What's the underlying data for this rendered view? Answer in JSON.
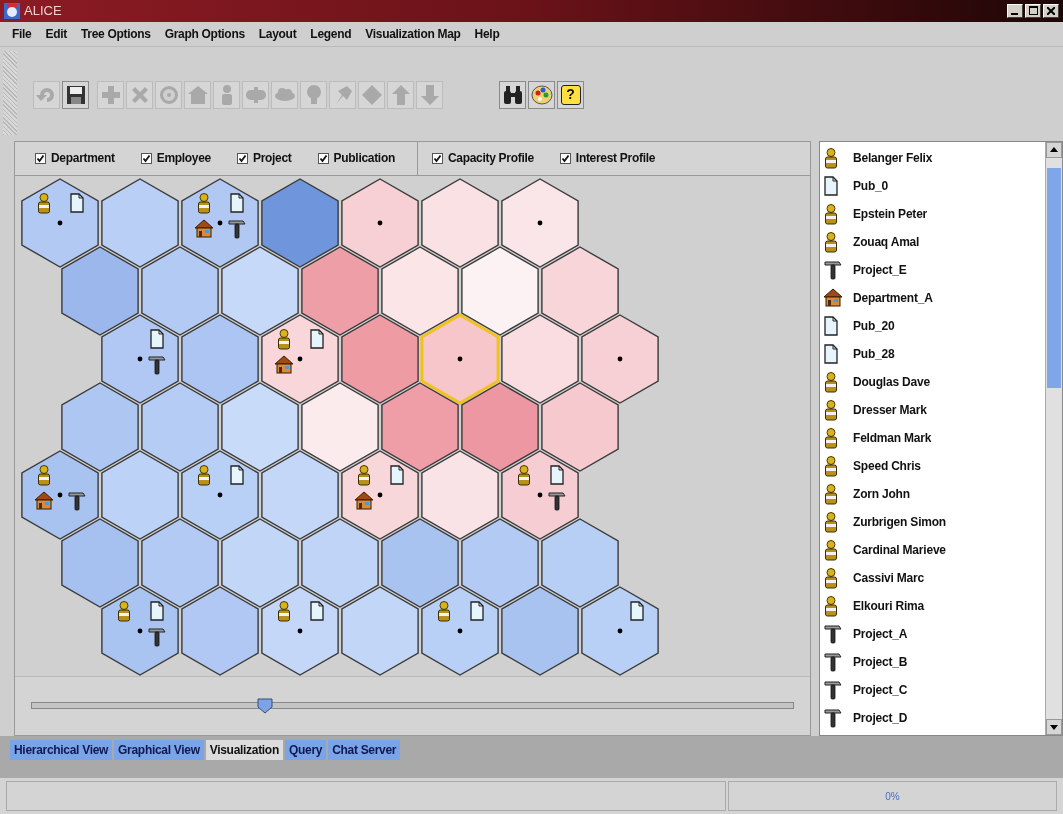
{
  "window": {
    "title": "ALICE"
  },
  "menu": [
    "File",
    "Edit",
    "Tree Options",
    "Graph Options",
    "Layout",
    "Legend",
    "Visualization Map",
    "Help"
  ],
  "toolbar": [
    [
      {
        "kind": "undo",
        "disabled": true
      },
      {
        "kind": "save",
        "disabled": false
      }
    ],
    [
      {
        "kind": "add",
        "disabled": true
      },
      {
        "kind": "delete",
        "disabled": true
      },
      {
        "kind": "target",
        "disabled": true
      },
      {
        "kind": "house",
        "disabled": true
      },
      {
        "kind": "person",
        "disabled": true
      },
      {
        "kind": "link",
        "disabled": true
      },
      {
        "kind": "cloud",
        "disabled": true
      },
      {
        "kind": "bulb",
        "disabled": true
      },
      {
        "kind": "pin",
        "disabled": true
      },
      {
        "kind": "diamond",
        "disabled": true
      },
      {
        "kind": "up",
        "disabled": true
      },
      {
        "kind": "down",
        "disabled": true
      }
    ],
    [
      {
        "kind": "binoculars",
        "disabled": false
      },
      {
        "kind": "palette",
        "disabled": false
      },
      {
        "kind": "help",
        "disabled": false,
        "label": "?"
      }
    ]
  ],
  "filters": [
    [
      {
        "label": "Department",
        "checked": true
      },
      {
        "label": "Employee",
        "checked": true
      },
      {
        "label": "Project",
        "checked": true
      },
      {
        "label": "Publication",
        "checked": true
      }
    ],
    [
      {
        "label": "Capacity Profile",
        "checked": true
      },
      {
        "label": "Interest Profile",
        "checked": true
      }
    ]
  ],
  "map": {
    "rows": [
      [
        {
          "color": "#b2c9f3",
          "selected": false,
          "dot": true,
          "markers": [
            {
              "kind": "employee"
            },
            {
              "kind": "publication"
            }
          ]
        },
        {
          "color": "#b9cff6",
          "selected": false,
          "dot": false
        },
        {
          "color": "#b0c8f2",
          "selected": false,
          "dot": true,
          "markers": [
            {
              "kind": "employee"
            },
            {
              "kind": "publication"
            },
            {
              "kind": "department"
            },
            {
              "kind": "project"
            }
          ]
        },
        {
          "color": "#6f95dd",
          "selected": false,
          "dot": false
        },
        {
          "color": "#f6d0d4",
          "selected": false,
          "dot": true
        },
        {
          "color": "#f9e1e4",
          "selected": false,
          "dot": false
        },
        {
          "color": "#fae6e8",
          "selected": false,
          "dot": true
        }
      ],
      [
        {
          "color": "#9bb7ec",
          "selected": false,
          "dot": false
        },
        {
          "color": "#b3cbf4",
          "selected": false,
          "dot": false
        },
        {
          "color": "#c6d9f8",
          "selected": false,
          "dot": false
        },
        {
          "color": "#ee9ea7",
          "selected": false,
          "dot": false
        },
        {
          "color": "#fbe5e7",
          "selected": false,
          "dot": false
        },
        {
          "color": "#fdf2f3",
          "selected": false,
          "dot": false
        },
        {
          "color": "#f7d5d9",
          "selected": false,
          "dot": false
        }
      ],
      [
        {
          "color": "#b0c8f3",
          "selected": false,
          "dot": true,
          "markers": [
            {
              "kind": "publication"
            },
            {
              "kind": "project"
            }
          ]
        },
        {
          "color": "#acc5f2",
          "selected": false,
          "dot": false
        },
        {
          "color": "#f8d6da",
          "selected": false,
          "dot": true,
          "markers": [
            {
              "kind": "employee"
            },
            {
              "kind": "publication"
            },
            {
              "kind": "department"
            }
          ]
        },
        {
          "color": "#ef9ba4",
          "selected": false,
          "dot": false
        },
        {
          "color": "#f6c6cb",
          "selected": true,
          "dot": true
        },
        {
          "color": "#f9dde0",
          "selected": false,
          "dot": false
        },
        {
          "color": "#f6d0d4",
          "selected": false,
          "dot": true
        }
      ],
      [
        {
          "color": "#aec6f2",
          "selected": false,
          "dot": false
        },
        {
          "color": "#b5ccf5",
          "selected": false,
          "dot": false
        },
        {
          "color": "#c8dbf9",
          "selected": false,
          "dot": false
        },
        {
          "color": "#fcebed",
          "selected": false,
          "dot": false
        },
        {
          "color": "#ef9ea7",
          "selected": false,
          "dot": false
        },
        {
          "color": "#ec97a1",
          "selected": false,
          "dot": false
        },
        {
          "color": "#f5c9ce",
          "selected": false,
          "dot": false
        }
      ],
      [
        {
          "color": "#a9c3f1",
          "selected": false,
          "dot": true,
          "markers": [
            {
              "kind": "employee"
            },
            {
              "kind": "department"
            },
            {
              "kind": "project"
            }
          ]
        },
        {
          "color": "#bcd2f7",
          "selected": false,
          "dot": false
        },
        {
          "color": "#b8cff6",
          "selected": false,
          "dot": true,
          "markers": [
            {
              "kind": "employee"
            },
            {
              "kind": "publication"
            }
          ]
        },
        {
          "color": "#c4d7f8",
          "selected": false,
          "dot": false
        },
        {
          "color": "#f8d7db",
          "selected": false,
          "dot": true,
          "markers": [
            {
              "kind": "employee"
            },
            {
              "kind": "publication"
            },
            {
              "kind": "department"
            }
          ]
        },
        {
          "color": "#fae3e6",
          "selected": false,
          "dot": false
        },
        {
          "color": "#f6cdd2",
          "selected": false,
          "dot": true,
          "markers": [
            {
              "kind": "employee"
            },
            {
              "kind": "publication"
            },
            {
              "kind": "project"
            }
          ]
        }
      ],
      [
        {
          "color": "#a6c1f0",
          "selected": false,
          "dot": false
        },
        {
          "color": "#b2caf4",
          "selected": false,
          "dot": false
        },
        {
          "color": "#c2d6f8",
          "selected": false,
          "dot": false
        },
        {
          "color": "#bfd4f7",
          "selected": false,
          "dot": false
        },
        {
          "color": "#a9c3f1",
          "selected": false,
          "dot": false
        },
        {
          "color": "#b3cbf4",
          "selected": false,
          "dot": false
        },
        {
          "color": "#b7cef5",
          "selected": false,
          "dot": false
        }
      ],
      [
        {
          "color": "#aac4f1",
          "selected": false,
          "dot": true,
          "markers": [
            {
              "kind": "employee"
            },
            {
              "kind": "publication"
            },
            {
              "kind": "project"
            }
          ]
        },
        {
          "color": "#b0c8f3",
          "selected": false,
          "dot": false
        },
        {
          "color": "#c4d7f8",
          "selected": false,
          "dot": true,
          "markers": [
            {
              "kind": "employee"
            },
            {
              "kind": "publication"
            }
          ]
        },
        {
          "color": "#c2d6f8",
          "selected": false,
          "dot": false
        },
        {
          "color": "#b8cff6",
          "selected": false,
          "dot": true,
          "markers": [
            {
              "kind": "employee"
            },
            {
              "kind": "publication"
            }
          ]
        },
        {
          "color": "#a9c3f1",
          "selected": false,
          "dot": false
        },
        {
          "color": "#b8cff6",
          "selected": false,
          "dot": true,
          "markers": [
            {
              "kind": "publication"
            }
          ]
        }
      ]
    ]
  },
  "slider": {
    "level": 0.3
  },
  "list": [
    {
      "kind": "employee",
      "label": "Belanger Felix"
    },
    {
      "kind": "publication",
      "label": "Pub_0"
    },
    {
      "kind": "employee",
      "label": "Epstein Peter"
    },
    {
      "kind": "employee",
      "label": "Zouaq Amal"
    },
    {
      "kind": "project",
      "label": "Project_E"
    },
    {
      "kind": "department",
      "label": "Department_A"
    },
    {
      "kind": "publication",
      "label": "Pub_20"
    },
    {
      "kind": "publication",
      "label": "Pub_28"
    },
    {
      "kind": "employee",
      "label": "Douglas Dave"
    },
    {
      "kind": "employee",
      "label": "Dresser Mark"
    },
    {
      "kind": "employee",
      "label": "Feldman Mark"
    },
    {
      "kind": "employee",
      "label": "Speed Chris"
    },
    {
      "kind": "employee",
      "label": "Zorn John"
    },
    {
      "kind": "employee",
      "label": "Zurbrigen Simon"
    },
    {
      "kind": "employee",
      "label": "Cardinal Marieve"
    },
    {
      "kind": "employee",
      "label": "Cassivi Marc"
    },
    {
      "kind": "employee",
      "label": "Elkouri Rima"
    },
    {
      "kind": "project",
      "label": "Project_A"
    },
    {
      "kind": "project",
      "label": "Project_B"
    },
    {
      "kind": "project",
      "label": "Project_C"
    },
    {
      "kind": "project",
      "label": "Project_D"
    }
  ],
  "tabs": [
    {
      "label": "Hierarchical View",
      "selected": false
    },
    {
      "label": "Graphical View",
      "selected": false
    },
    {
      "label": "Visualization",
      "selected": true
    },
    {
      "label": "Query",
      "selected": false
    },
    {
      "label": "Chat Server",
      "selected": false
    }
  ],
  "status_bar": {
    "progress": "0%"
  }
}
